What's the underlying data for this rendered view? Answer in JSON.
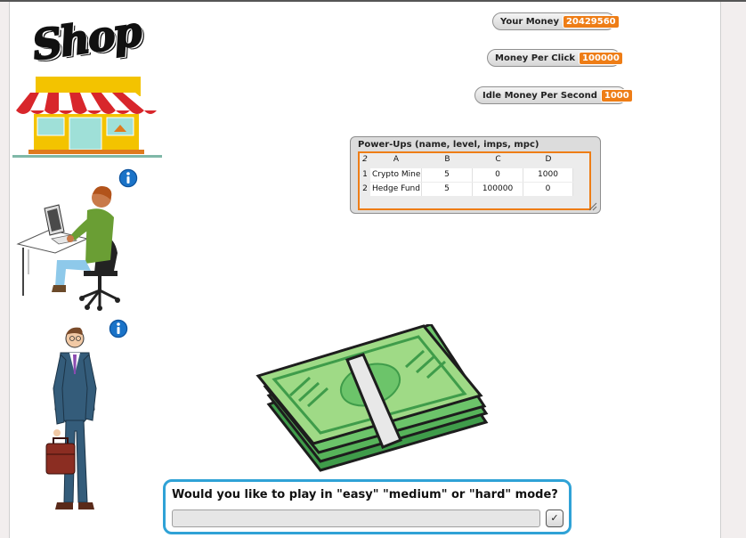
{
  "monitors": {
    "your_money": {
      "label": "Your Money",
      "value": "20429560"
    },
    "money_per_click": {
      "label": "Money Per Click",
      "value": "100000"
    },
    "idle_money": {
      "label": "Idle Money Per Second",
      "value": "1000"
    }
  },
  "powerups": {
    "title": "Power-Ups (name, level, imps, mpc)",
    "corner": "2",
    "columns": [
      "A",
      "B",
      "C",
      "D"
    ],
    "rows": [
      {
        "index": "1",
        "cells": [
          "Crypto Miner",
          "5",
          "0",
          "1000"
        ]
      },
      {
        "index": "2",
        "cells": [
          "Hedge Fund",
          "5",
          "100000",
          "0"
        ]
      }
    ]
  },
  "shop_logo_text": "Shop",
  "ask": {
    "question": "Would you like to play in \"easy\" \"medium\" or \"hard\" mode?",
    "input_value": "",
    "submit_symbol": "✓"
  },
  "colors": {
    "accent_orange": "#ee7d16",
    "ask_border": "#2fa2d6",
    "money_green": "#57b45a",
    "info_blue": "#1a73c8"
  },
  "icons": {
    "info": "info-icon",
    "check": "check-icon"
  }
}
